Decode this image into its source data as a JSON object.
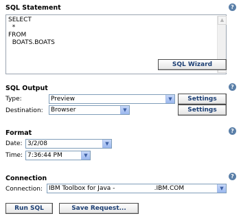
{
  "sql_statement": {
    "title": "SQL Statement",
    "text": "SELECT\n  *\nFROM\n  BOATS.BOATS",
    "wizard_button": "SQL Wizard"
  },
  "sql_output": {
    "title": "SQL Output",
    "type_label": "Type:",
    "type_value": "Preview",
    "destination_label": "Destination:",
    "destination_value": "Browser",
    "settings_label": "Settings"
  },
  "format": {
    "title": "Format",
    "date_label": "Date:",
    "date_value": "3/2/08",
    "time_label": "Time:",
    "time_value": "7:36:44 PM"
  },
  "connection": {
    "title": "Connection",
    "connection_label": "Connection:",
    "connection_value": "IBM Toolbox for Java -                    .IBM.COM"
  },
  "actions": {
    "run_sql": "Run SQL",
    "save_request": "Save Request..."
  },
  "icons": {
    "help": "help-icon",
    "dropdown": "chevron-down-icon"
  },
  "colors": {
    "help_icon": "#5a7fa8",
    "button_text": "#1b3e73",
    "dropdown_button": "#9ab7ee"
  }
}
